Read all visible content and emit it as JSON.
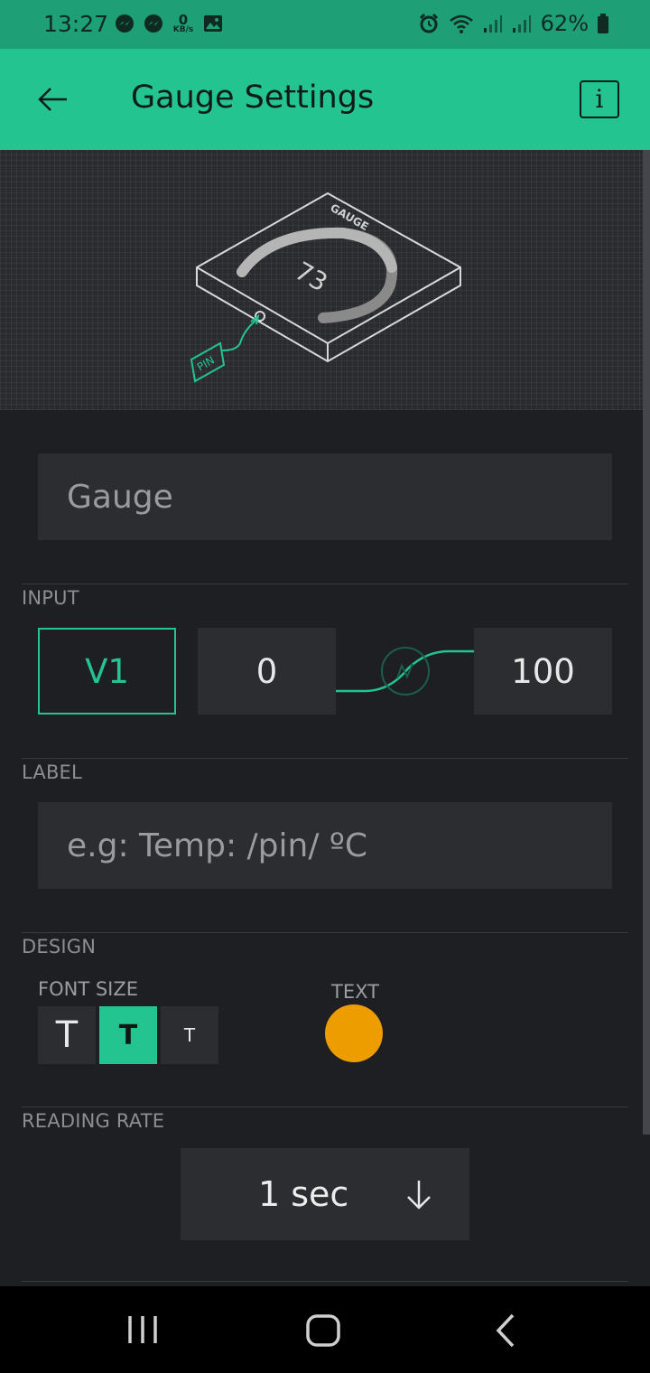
{
  "status_bar": {
    "time": "13:27",
    "net_speed_value": "0",
    "net_speed_unit": "KB/s",
    "battery": "62%",
    "icons_left": [
      "messenger-icon",
      "messenger-icon",
      "net-speed",
      "gallery-icon"
    ],
    "icons_right": [
      "alarm-icon",
      "wifi-icon",
      "signal-icon",
      "signal-icon",
      "battery-icon"
    ]
  },
  "app_bar": {
    "title": "Gauge Settings",
    "back_icon": "back-arrow-icon",
    "info_label": "i"
  },
  "hero": {
    "widget_name": "GAUGE",
    "gauge_value": "73",
    "pin_label": "PIN"
  },
  "name_field": {
    "value": "Gauge"
  },
  "input": {
    "section_title": "INPUT",
    "pin": "V1",
    "min": "0",
    "max": "100"
  },
  "label": {
    "section_title": "LABEL",
    "placeholder": "e.g: Temp: /pin/ ºC"
  },
  "design": {
    "section_title": "DESIGN",
    "font_size_title": "FONT SIZE",
    "font_sizes": [
      {
        "glyph": "T",
        "size": "large",
        "selected": false
      },
      {
        "glyph": "T",
        "size": "medium",
        "selected": true
      },
      {
        "glyph": "T",
        "size": "small",
        "selected": false
      }
    ],
    "text_color_title": "TEXT",
    "text_color": "#ED9D00"
  },
  "reading_rate": {
    "section_title": "READING RATE",
    "value": "1 sec"
  },
  "colors": {
    "accent": "#23C48F",
    "background": "#1E1F23",
    "field": "#2C2D31"
  }
}
